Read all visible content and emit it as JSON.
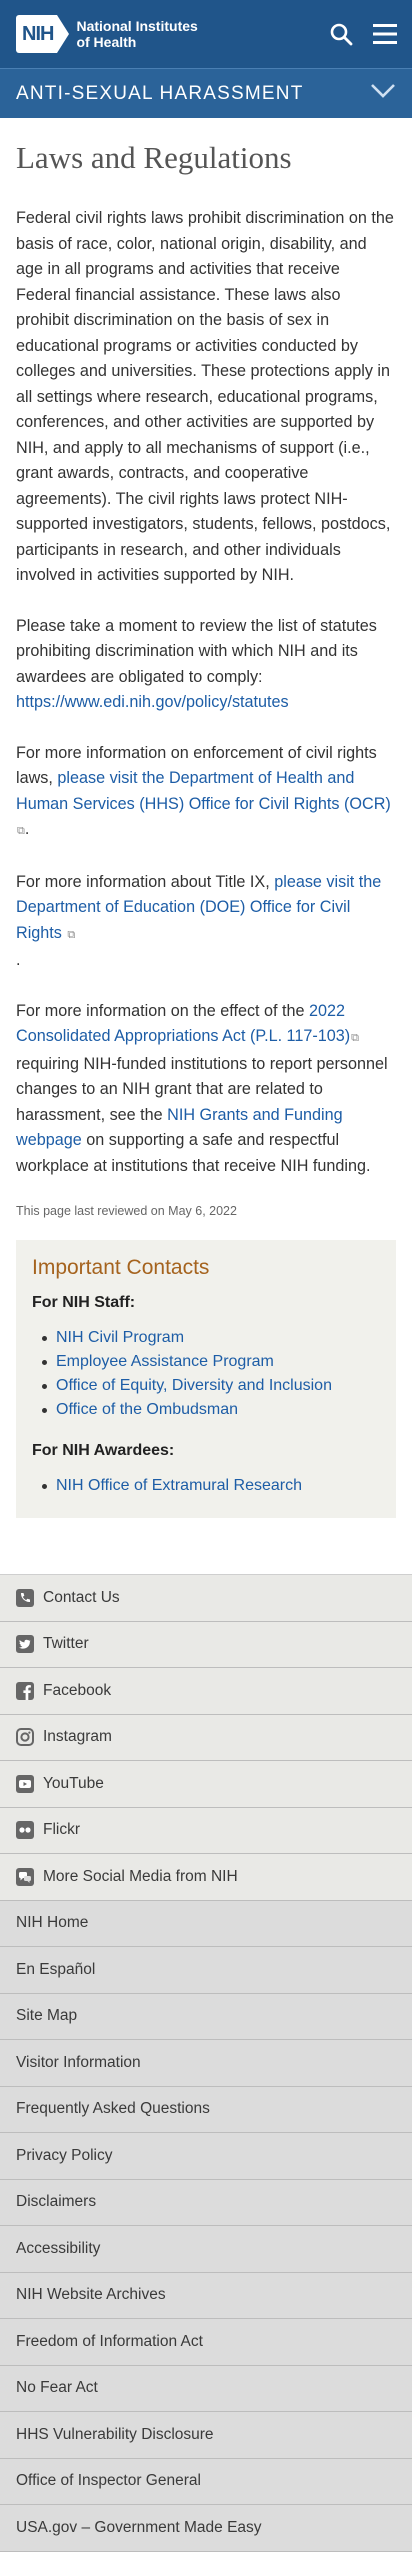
{
  "header": {
    "logo_abbr": "NIH",
    "logo_line1": "National Institutes",
    "logo_line2": "of Health"
  },
  "section_bar": {
    "title": "ANTI-SEXUAL HARASSMENT"
  },
  "page": {
    "title": "Laws and Regulations",
    "p1": "Federal civil rights laws prohibit discrimination on the basis of race, color, national origin, disability, and age in all programs and activities that receive Federal financial assistance. These laws also prohibit discrimination on the basis of sex in educational programs or activities conducted by colleges and universities.  These protections apply in all settings where research, educational programs, conferences, and other activities are supported by NIH, and apply to all mechanisms of support (i.e., grant awards, contracts, and cooperative agreements).  The civil rights laws protect NIH-supported investigators, students, fellows, postdocs, participants in research, and other individuals involved in activities supported by NIH.",
    "p2_text": "Please take a moment to review the list of statutes prohibiting discrimination with which NIH and its awardees are obligated to comply:",
    "p2_link": "https://www.edi.nih.gov/policy/statutes",
    "p3_text": "For more information on enforcement of civil rights laws,",
    "p3_link": "please visit the Department of Health and Human Services (HHS) Office for Civil Rights (OCR)",
    "p3_end": ".",
    "p4_text": "For more information about Title IX,",
    "p4_link": "please visit the Department of Education (DOE) Office for Civil Rights",
    "p4_end": ".",
    "p5_text1": "For more information on the effect of the",
    "p5_link1": "2022 Consolidated Appropriations Act (P.L. 117-103)",
    "p5_text2": "requiring NIH-funded institutions to report personnel changes to an NIH grant that are related to harassment, see the",
    "p5_link2": "NIH Grants and Funding webpage",
    "p5_text3": "on supporting a safe and respectful workplace at institutions that receive NIH funding.",
    "reviewed": "This page last reviewed on May 6, 2022"
  },
  "contacts": {
    "title": "Important Contacts",
    "staff_heading": "For NIH Staff:",
    "staff": [
      "NIH Civil Program",
      "Employee Assistance Program",
      "Office of Equity, Diversity and Inclusion",
      "Office of the Ombudsman"
    ],
    "awardees_heading": "For NIH Awardees:",
    "awardees": [
      "NIH Office of Extramural Research"
    ]
  },
  "footer": {
    "social": [
      {
        "label": "Contact Us",
        "icon": "phone-icon"
      },
      {
        "label": "Twitter",
        "icon": "twitter-icon"
      },
      {
        "label": "Facebook",
        "icon": "facebook-icon"
      },
      {
        "label": "Instagram",
        "icon": "instagram-icon"
      },
      {
        "label": "YouTube",
        "icon": "youtube-icon"
      },
      {
        "label": "Flickr",
        "icon": "flickr-icon"
      },
      {
        "label": "More Social Media from NIH",
        "icon": "social-media-icon"
      }
    ],
    "links": [
      "NIH Home",
      "En Español",
      "Site Map",
      "Visitor Information",
      "Frequently Asked Questions",
      "Privacy Policy",
      "Disclaimers",
      "Accessibility",
      "NIH Website Archives",
      "Freedom of Information Act",
      "No Fear Act",
      "HHS Vulnerability Disclosure",
      "Office of Inspector General",
      "USA.gov – Government Made Easy"
    ]
  },
  "colors": {
    "header_bg": "#20558a",
    "section_bg": "#2b6399",
    "link": "#1d5da6",
    "contacts_title": "#a5631e"
  }
}
